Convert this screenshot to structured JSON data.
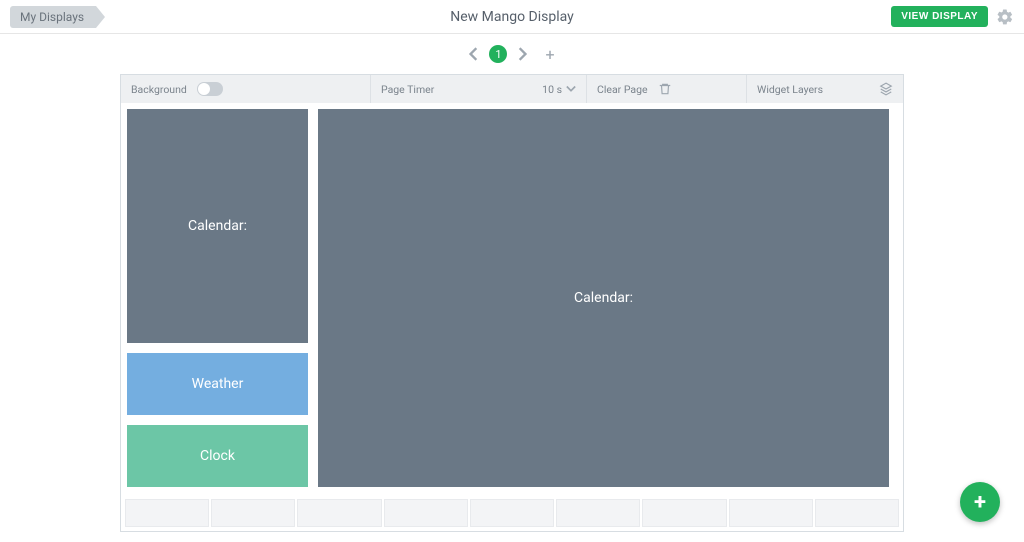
{
  "header": {
    "breadcrumb": "My Displays",
    "title": "New Mango Display",
    "view_button": "VIEW DISPLAY"
  },
  "pager": {
    "current": "1"
  },
  "toolbar": {
    "background_label": "Background",
    "page_timer_label": "Page Timer",
    "page_timer_value": "10 s",
    "clear_page_label": "Clear Page",
    "widget_layers_label": "Widget Layers"
  },
  "widgets": {
    "calendar_small": "Calendar:",
    "weather": "Weather",
    "clock": "Clock",
    "calendar_large": "Calendar:"
  }
}
